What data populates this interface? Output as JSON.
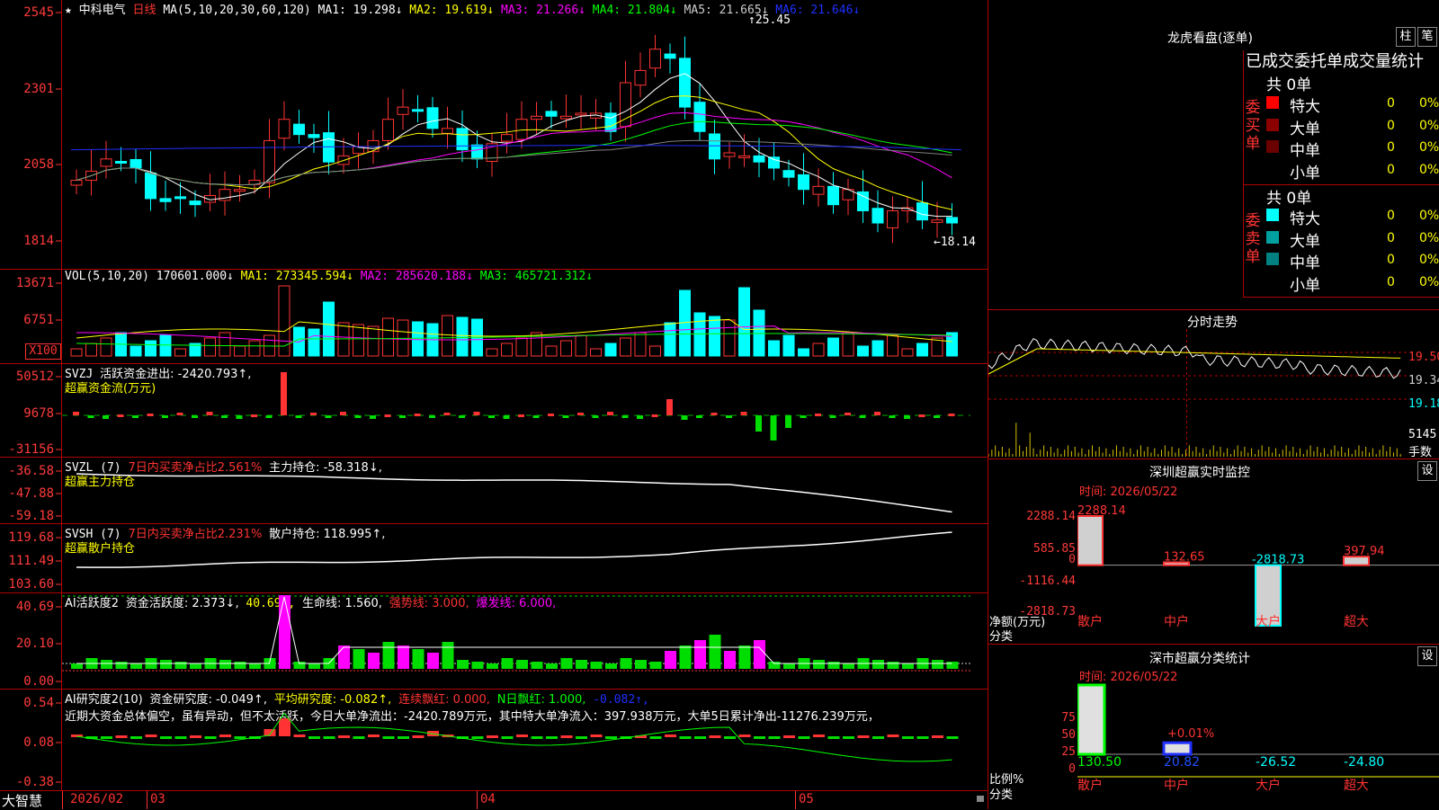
{
  "colors": {
    "up": "#ff3333",
    "down": "#00ffff",
    "bg": "#000000",
    "grid": "#b00000",
    "ma1": "#ffffff",
    "ma2": "#ffff00",
    "ma3": "#ff00ff",
    "ma4": "#00ff00",
    "ma5": "#808080",
    "ma6": "#2030ff"
  },
  "price_panel": {
    "star": "★",
    "name": "中科电气",
    "period": "日线",
    "ma_param": "MA(5,10,20,30,60,120)",
    "ma1": "MA1: 19.298↓",
    "ma2": "MA2: 19.619↓",
    "ma3": "MA3: 21.266↓",
    "ma4": "MA4: 21.804↓",
    "ma5": "MA5: 21.665↓",
    "ma6": "MA6: 21.646↓",
    "high_mark": "25.45",
    "low_mark": "←18.14",
    "y_ticks": [
      "2545",
      "2301",
      "2058",
      "1814"
    ]
  },
  "vol_panel": {
    "name": "VOL(5,10,20)",
    "vol": "170601.000↓",
    "ma1": "MA1: 273345.594↓",
    "ma2": "MA2: 285620.188↓",
    "ma3": "MA3: 465721.312↓",
    "y_ticks": [
      "13671",
      "6751"
    ],
    "unit": "X100"
  },
  "svzj_panel": {
    "name": "SVZJ",
    "label": "活跃资金进出: -2420.793↑,",
    "sub": "超赢资金流(万元)",
    "y_ticks": [
      "50512",
      "9678",
      "-31156"
    ]
  },
  "svzl_panel": {
    "name": "SVZL (7)",
    "label1": "7日内买卖净占比2.561%",
    "label2": "主力持仓: -58.318↓,",
    "sub": "超赢主力持仓",
    "y_ticks": [
      "-36.58",
      "-47.88",
      "-59.18"
    ]
  },
  "svsh_panel": {
    "name": "SVSH (7)",
    "label1": "7日内买卖净占比2.231%",
    "label2": "散户持仓: 118.995↑,",
    "sub": "超赢散户持仓",
    "y_ticks": [
      "119.68",
      "111.49",
      "103.60"
    ]
  },
  "ai_activity": {
    "name": "AI活跃度2",
    "label1": "资金活跃度: 2.373↓,",
    "v1": "40.690,",
    "label2": "生命线: 1.560,",
    "label3": "强势线: 3.000,",
    "label4": "爆发线: 6.000,",
    "y_ticks": [
      "40.69",
      "20.10",
      "0.00"
    ]
  },
  "ai_research": {
    "name": "AI研究度2(10)",
    "label1": "资金研究度: -0.049↑,",
    "label2": "平均研究度: -0.082↑,",
    "label3": "连续飘红: 0.000,",
    "label4": "N日飘红: 1.000,",
    "label5": "-0.082↑,",
    "text": "近期大资金总体偏空，虽有异动，但不太活跃，今日大单净流出：-2420.789万元，其中特大单净流入：397.938万元，大单5日累计净出-11276.239万元，",
    "y_ticks": [
      "0.54",
      "0.08",
      "-0.38"
    ]
  },
  "x_axis": {
    "app": "大智慧",
    "labels": [
      "2026/02",
      "03",
      "04",
      "05"
    ]
  },
  "dragon": {
    "title": "龙虎看盘(逐单)",
    "btn1": "柱",
    "btn2": "笔",
    "subtitle": "已成交委托单成交量统计",
    "buy": {
      "side": "委买单",
      "total": "共 0单",
      "rows": [
        {
          "name": "特大",
          "n": "0",
          "p": "0%"
        },
        {
          "name": "大单",
          "n": "0",
          "p": "0%"
        },
        {
          "name": "中单",
          "n": "0",
          "p": "0%"
        },
        {
          "name": "小单",
          "n": "0",
          "p": "0%"
        }
      ]
    },
    "sell": {
      "side": "委卖单",
      "total": "共 0单",
      "rows": [
        {
          "name": "特大",
          "n": "0",
          "p": "0%"
        },
        {
          "name": "大单",
          "n": "0",
          "p": "0%"
        },
        {
          "name": "中单",
          "n": "0",
          "p": "0%"
        },
        {
          "name": "小单",
          "n": "0",
          "p": "0%"
        }
      ]
    }
  },
  "intraday": {
    "title": "分时走势",
    "y_ticks": [
      "19.50",
      "19.34",
      "19.18"
    ],
    "vol_label": "5145",
    "unit": "手数"
  },
  "monitor": {
    "title": "深圳超赢实时监控",
    "btn": "设",
    "time": "时间: 2026/05/22",
    "y_ticks": [
      "2288.14",
      "585.85",
      "0",
      "-1116.44",
      "-2818.73"
    ],
    "values": [
      {
        "v": "2288.14",
        "n": 2288.14
      },
      {
        "v": "132.65",
        "n": 132.65
      },
      {
        "v": "-2818.73",
        "n": -2818.73
      },
      {
        "v": "397.94",
        "n": 397.94
      }
    ],
    "categories": [
      "散户",
      "中户",
      "大户",
      "超大"
    ],
    "yname": "净额(万元)",
    "xname": "分类"
  },
  "classify": {
    "title": "深市超赢分类统计",
    "btn": "设",
    "time": "时间: 2026/05/22",
    "y_ticks": [
      "75",
      "50",
      "25",
      "0"
    ],
    "values": [
      {
        "v": "130.50",
        "n": 130.5
      },
      {
        "v": "20.82",
        "n": 20.82
      },
      {
        "v": "-26.52",
        "n": -26.52
      },
      {
        "v": "-24.80",
        "n": -24.8
      }
    ],
    "bar_label": "+0.01%",
    "categories": [
      "散户",
      "中户",
      "大户",
      "超大"
    ],
    "yname": "比例%",
    "xname": "分类"
  }
}
